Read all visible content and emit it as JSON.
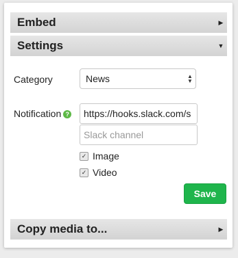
{
  "sections": {
    "embed": {
      "title": "Embed",
      "arrow": "▶"
    },
    "settings": {
      "title": "Settings",
      "arrow": "▼"
    },
    "copy_media": {
      "title": "Copy media to...",
      "arrow": "▶"
    }
  },
  "settings_form": {
    "category_label": "Category",
    "category_value": "News",
    "notification_label": "Notification",
    "help_icon_glyph": "?",
    "webhook_value": "https://hooks.slack.com/s",
    "channel_placeholder": "Slack channel",
    "options": [
      {
        "label": "Image",
        "checked": true
      },
      {
        "label": "Video",
        "checked": true
      }
    ],
    "save_label": "Save"
  },
  "colors": {
    "save_button": "#1fb54c",
    "help_icon": "#5db946"
  }
}
